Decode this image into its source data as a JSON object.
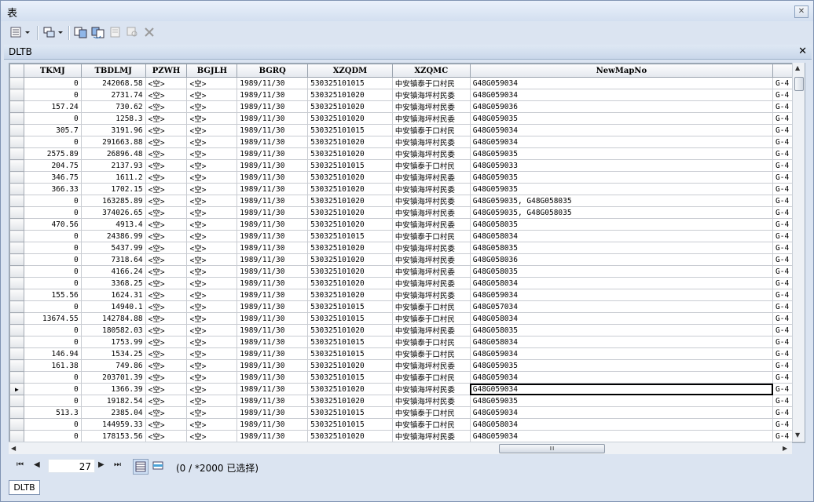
{
  "window": {
    "title": "表"
  },
  "table_tab": {
    "title": "DLTB"
  },
  "columns": [
    "TKMJ",
    "TBDLMJ",
    "PZWH",
    "BGJLH",
    "BGRQ",
    "XZQDM",
    "XZQMC",
    "NewMapNo",
    ""
  ],
  "rows": [
    [
      "0",
      "242068.58",
      "<空>",
      "<空>",
      "1989/11/30",
      "530325101015",
      "中安镇泰于口村民",
      "G48G059034",
      "G-4"
    ],
    [
      "0",
      "2731.74",
      "<空>",
      "<空>",
      "1989/11/30",
      "530325101020",
      "中安镇海坪村民委",
      "G48G059034",
      "G-4"
    ],
    [
      "157.24",
      "730.62",
      "<空>",
      "<空>",
      "1989/11/30",
      "530325101020",
      "中安镇海坪村民委",
      "G48G059036",
      "G-4"
    ],
    [
      "0",
      "1258.3",
      "<空>",
      "<空>",
      "1989/11/30",
      "530325101020",
      "中安镇海坪村民委",
      "G48G059035",
      "G-4"
    ],
    [
      "305.7",
      "3191.96",
      "<空>",
      "<空>",
      "1989/11/30",
      "530325101015",
      "中安镇泰于口村民",
      "G48G059034",
      "G-4"
    ],
    [
      "0",
      "291663.88",
      "<空>",
      "<空>",
      "1989/11/30",
      "530325101020",
      "中安镇海坪村民委",
      "G48G059034",
      "G-4"
    ],
    [
      "2575.89",
      "26896.48",
      "<空>",
      "<空>",
      "1989/11/30",
      "530325101020",
      "中安镇海坪村民委",
      "G48G059035",
      "G-4"
    ],
    [
      "204.75",
      "2137.93",
      "<空>",
      "<空>",
      "1989/11/30",
      "530325101015",
      "中安镇泰于口村民",
      "G48G059033",
      "G-4"
    ],
    [
      "346.75",
      "1611.2",
      "<空>",
      "<空>",
      "1989/11/30",
      "530325101020",
      "中安镇海坪村民委",
      "G48G059035",
      "G-4"
    ],
    [
      "366.33",
      "1702.15",
      "<空>",
      "<空>",
      "1989/11/30",
      "530325101020",
      "中安镇海坪村民委",
      "G48G059035",
      "G-4"
    ],
    [
      "0",
      "163285.89",
      "<空>",
      "<空>",
      "1989/11/30",
      "530325101020",
      "中安镇海坪村民委",
      "G48G059035, G48G058035",
      "G-4"
    ],
    [
      "0",
      "374026.65",
      "<空>",
      "<空>",
      "1989/11/30",
      "530325101020",
      "中安镇海坪村民委",
      "G48G059035, G48G058035",
      "G-4"
    ],
    [
      "470.56",
      "4913.4",
      "<空>",
      "<空>",
      "1989/11/30",
      "530325101020",
      "中安镇海坪村民委",
      "G48G058035",
      "G-4"
    ],
    [
      "0",
      "24386.99",
      "<空>",
      "<空>",
      "1989/11/30",
      "530325101015",
      "中安镇泰于口村民",
      "G48G058034",
      "G-4"
    ],
    [
      "0",
      "5437.99",
      "<空>",
      "<空>",
      "1989/11/30",
      "530325101020",
      "中安镇海坪村民委",
      "G48G058035",
      "G-4"
    ],
    [
      "0",
      "7318.64",
      "<空>",
      "<空>",
      "1989/11/30",
      "530325101020",
      "中安镇海坪村民委",
      "G48G058036",
      "G-4"
    ],
    [
      "0",
      "4166.24",
      "<空>",
      "<空>",
      "1989/11/30",
      "530325101020",
      "中安镇海坪村民委",
      "G48G058035",
      "G-4"
    ],
    [
      "0",
      "3368.25",
      "<空>",
      "<空>",
      "1989/11/30",
      "530325101020",
      "中安镇海坪村民委",
      "G48G058034",
      "G-4"
    ],
    [
      "155.56",
      "1624.31",
      "<空>",
      "<空>",
      "1989/11/30",
      "530325101020",
      "中安镇海坪村民委",
      "G48G059034",
      "G-4"
    ],
    [
      "0",
      "14940.1",
      "<空>",
      "<空>",
      "1989/11/30",
      "530325101015",
      "中安镇泰于口村民",
      "G48G057034",
      "G-4"
    ],
    [
      "13674.55",
      "142784.88",
      "<空>",
      "<空>",
      "1989/11/30",
      "530325101015",
      "中安镇泰于口村民",
      "G48G058034",
      "G-4"
    ],
    [
      "0",
      "180582.03",
      "<空>",
      "<空>",
      "1989/11/30",
      "530325101020",
      "中安镇海坪村民委",
      "G48G058035",
      "G-4"
    ],
    [
      "0",
      "1753.99",
      "<空>",
      "<空>",
      "1989/11/30",
      "530325101015",
      "中安镇泰于口村民",
      "G48G058034",
      "G-4"
    ],
    [
      "146.94",
      "1534.25",
      "<空>",
      "<空>",
      "1989/11/30",
      "530325101015",
      "中安镇泰于口村民",
      "G48G059034",
      "G-4"
    ],
    [
      "161.38",
      "749.86",
      "<空>",
      "<空>",
      "1989/11/30",
      "530325101020",
      "中安镇海坪村民委",
      "G48G059035",
      "G-4"
    ],
    [
      "0",
      "203701.39",
      "<空>",
      "<空>",
      "1989/11/30",
      "530325101015",
      "中安镇泰于口村民",
      "G48G059034",
      "G-4"
    ],
    [
      "0",
      "1366.39",
      "<空>",
      "<空>",
      "1989/11/30",
      "530325101020",
      "中安镇海坪村民委",
      "G48G059034",
      "G-4"
    ],
    [
      "0",
      "19182.54",
      "<空>",
      "<空>",
      "1989/11/30",
      "530325101020",
      "中安镇海坪村民委",
      "G48G059035",
      "G-4"
    ],
    [
      "513.3",
      "2385.04",
      "<空>",
      "<空>",
      "1989/11/30",
      "530325101015",
      "中安镇泰于口村民",
      "G48G059034",
      "G-4"
    ],
    [
      "0",
      "144959.33",
      "<空>",
      "<空>",
      "1989/11/30",
      "530325101015",
      "中安镇泰于口村民",
      "G48G058034",
      "G-4"
    ],
    [
      "0",
      "178153.56",
      "<空>",
      "<空>",
      "1989/11/30",
      "530325101020",
      "中安镇海坪村民委",
      "G48G059034",
      "G-4"
    ]
  ],
  "current_row_index": 26,
  "navigator": {
    "current_record": "27",
    "status": "(0 / *2000 已选择)"
  },
  "scrollbar_grip": "III",
  "bottom_tab": "DLTB",
  "toolbar_icons": [
    "table-options-icon",
    "related-tables-icon",
    "select-by-attributes-icon",
    "switch-selection-icon",
    "clear-selection-icon",
    "zoom-to-selected-icon",
    "delete-selected-icon"
  ]
}
